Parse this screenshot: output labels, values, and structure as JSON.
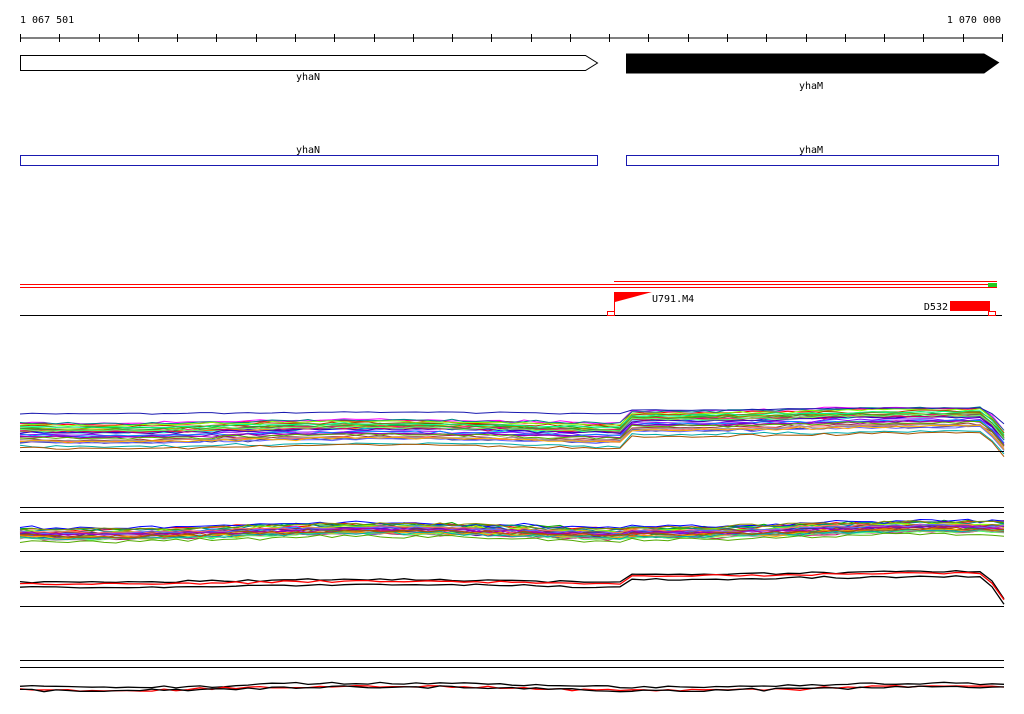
{
  "ruler": {
    "start_label": "1 067 501",
    "end_label": "1 070 000"
  },
  "colors": {
    "gene_fill_forward": "#ffffff",
    "gene_fill_reverse": "#000000",
    "cds_outline": "#1a1ab0",
    "feature_red": "#ff0000",
    "baseline": "#000000",
    "accent_green": "#22cc22"
  },
  "genes": [
    {
      "name": "yhaN",
      "strand": "+",
      "style": "open"
    },
    {
      "name": "yhaM",
      "strand": "+",
      "style": "filled"
    }
  ],
  "cds": [
    {
      "name": "yhaN"
    },
    {
      "name": "yhaM"
    }
  ],
  "features": [
    {
      "name": "U791.M4",
      "kind": "promoter-flag"
    },
    {
      "name": "D532",
      "kind": "terminator-block"
    }
  ],
  "tracks": [
    {
      "id": "expression-profiles-multi",
      "series_count": 30
    },
    {
      "id": "expression-profiles-compact",
      "series_count": 30
    },
    {
      "id": "expression-profiles-pair",
      "series_count": 3
    },
    {
      "id": "expression-profiles-bottom",
      "series_count": 3
    }
  ]
}
